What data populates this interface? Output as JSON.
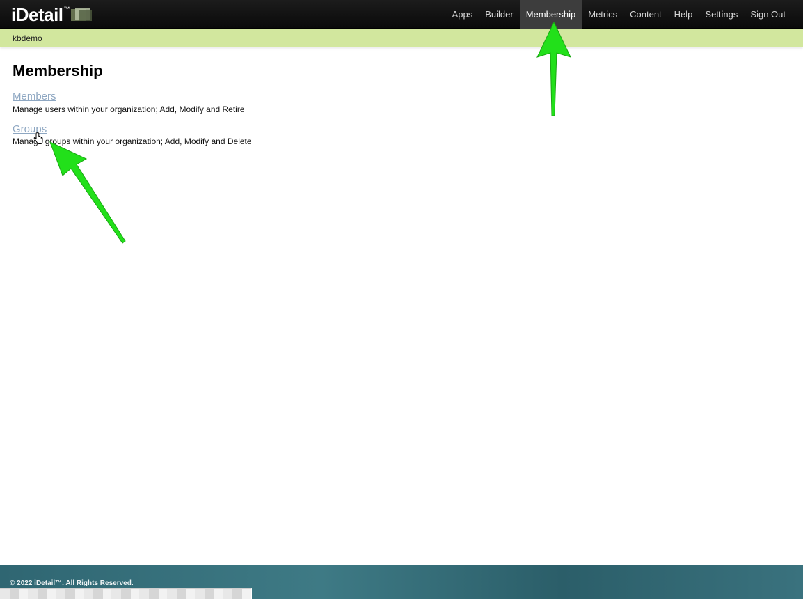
{
  "app": {
    "brand": "iDetail",
    "brand_mark": "™"
  },
  "nav": {
    "items": [
      {
        "label": "Apps"
      },
      {
        "label": "Builder"
      },
      {
        "label": "Membership",
        "active": true
      },
      {
        "label": "Metrics"
      },
      {
        "label": "Content"
      },
      {
        "label": "Help"
      },
      {
        "label": "Settings"
      },
      {
        "label": "Sign Out"
      }
    ]
  },
  "org": {
    "name": "kbdemo"
  },
  "main": {
    "title": "Membership",
    "sections": [
      {
        "link": "Members",
        "description": "Manage users within your organization; Add, Modify and Retire"
      },
      {
        "link": "Groups",
        "description": "Manage groups within your organization; Add, Modify and Delete"
      }
    ]
  },
  "footer": {
    "copyright": "© 2022 iDetail™.  All Rights Reserved."
  },
  "colors": {
    "navbar": "#111111",
    "nav_active": "#3d3d3d",
    "org_bar": "#d2e79e",
    "link": "#8ea7c2",
    "footer": "#2f6672",
    "annotation_arrow": "#22e01a"
  },
  "icons": {
    "cursor": "hand-pointer-icon",
    "annotations": [
      "up-arrow-annotation",
      "diagonal-arrow-annotation"
    ]
  }
}
